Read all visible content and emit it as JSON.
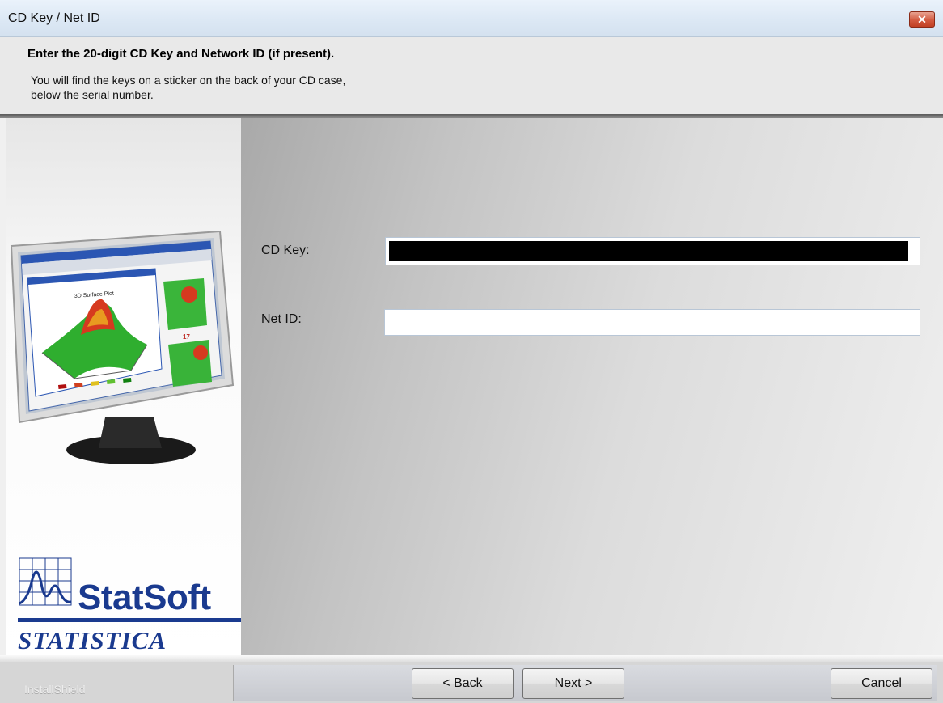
{
  "window": {
    "title": "CD Key / Net ID",
    "close_label": "✕"
  },
  "header": {
    "title": "Enter the 20-digit CD Key and Network ID (if present).",
    "description": "You will find the keys on a sticker on the back of your CD case,\nbelow the serial number."
  },
  "logo": {
    "brand": "StatSoft",
    "product": "STATISTICA"
  },
  "form": {
    "cd_key": {
      "label": "CD Key:",
      "value": ""
    },
    "net_id": {
      "label": "Net ID:",
      "value": ""
    }
  },
  "footer": {
    "brand": "InstallShield"
  },
  "buttons": {
    "back": {
      "prefix": "< ",
      "mnemonic": "B",
      "rest": "ack"
    },
    "next": {
      "mnemonic": "N",
      "rest": "ext >"
    },
    "cancel": "Cancel"
  },
  "colors": {
    "brand_blue": "#1a3a8f",
    "close_red": "#d35a40"
  }
}
